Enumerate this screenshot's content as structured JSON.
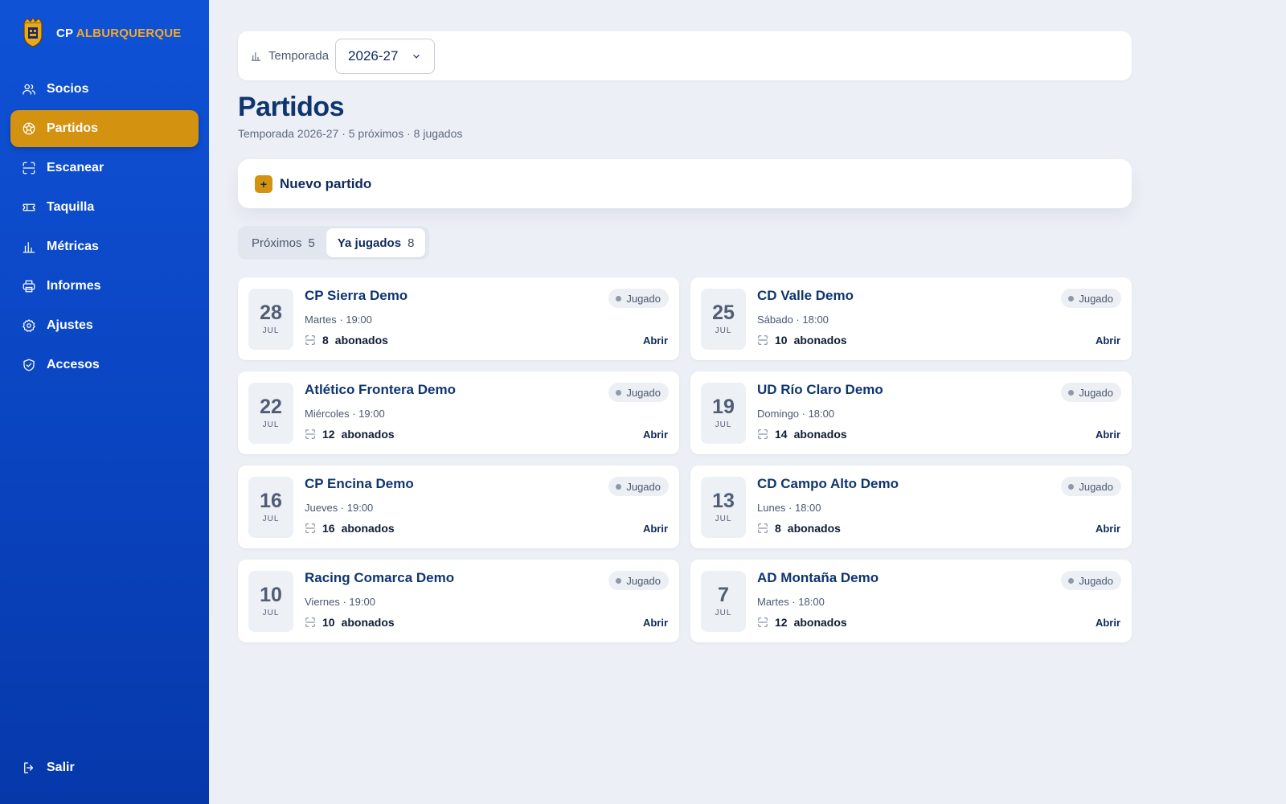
{
  "brand": {
    "prefix": "CP",
    "name": "ALBURQUERQUE",
    "logo_icon": "club-crest-icon",
    "accent_color": "#f0a92a"
  },
  "sidebar": {
    "items": [
      {
        "label": "Socios",
        "icon": "users-icon",
        "active": false
      },
      {
        "label": "Partidos",
        "icon": "soccer-ball-icon",
        "active": true
      },
      {
        "label": "Escanear",
        "icon": "scan-icon",
        "active": false
      },
      {
        "label": "Taquilla",
        "icon": "ticket-icon",
        "active": false
      },
      {
        "label": "Métricas",
        "icon": "bar-chart-icon",
        "active": false
      },
      {
        "label": "Informes",
        "icon": "printer-icon",
        "active": false
      },
      {
        "label": "Ajustes",
        "icon": "gear-icon",
        "active": false
      },
      {
        "label": "Accesos",
        "icon": "shield-icon",
        "active": false
      }
    ],
    "logout_label": "Salir"
  },
  "season": {
    "label": "Temporada",
    "selected": "2026-27"
  },
  "page": {
    "title": "Partidos",
    "subtitle": "Temporada 2026-27 · 5 próximos · 8 jugados"
  },
  "new_match": {
    "label": "Nuevo partido",
    "icon": "+"
  },
  "tabs": [
    {
      "label": "Próximos",
      "count": "5",
      "active": false
    },
    {
      "label": "Ya jugados",
      "count": "8",
      "active": true
    }
  ],
  "matches": [
    {
      "day": "28",
      "month": "JUL",
      "name": "CP Sierra Demo",
      "when": "Martes · 19:00",
      "subscribers": "8",
      "subscribers_label": "abonados",
      "status": "Jugado",
      "action": "Abrir"
    },
    {
      "day": "25",
      "month": "JUL",
      "name": "CD Valle Demo",
      "when": "Sábado · 18:00",
      "subscribers": "10",
      "subscribers_label": "abonados",
      "status": "Jugado",
      "action": "Abrir"
    },
    {
      "day": "22",
      "month": "JUL",
      "name": "Atlético Frontera Demo",
      "when": "Miércoles · 19:00",
      "subscribers": "12",
      "subscribers_label": "abonados",
      "status": "Jugado",
      "action": "Abrir"
    },
    {
      "day": "19",
      "month": "JUL",
      "name": "UD Río Claro Demo",
      "when": "Domingo · 18:00",
      "subscribers": "14",
      "subscribers_label": "abonados",
      "status": "Jugado",
      "action": "Abrir"
    },
    {
      "day": "16",
      "month": "JUL",
      "name": "CP Encina Demo",
      "when": "Jueves · 19:00",
      "subscribers": "16",
      "subscribers_label": "abonados",
      "status": "Jugado",
      "action": "Abrir"
    },
    {
      "day": "13",
      "month": "JUL",
      "name": "CD Campo Alto Demo",
      "when": "Lunes · 18:00",
      "subscribers": "8",
      "subscribers_label": "abonados",
      "status": "Jugado",
      "action": "Abrir"
    },
    {
      "day": "10",
      "month": "JUL",
      "name": "Racing Comarca Demo",
      "when": "Viernes · 19:00",
      "subscribers": "10",
      "subscribers_label": "abonados",
      "status": "Jugado",
      "action": "Abrir"
    },
    {
      "day": "7",
      "month": "JUL",
      "name": "AD Montaña Demo",
      "when": "Martes · 18:00",
      "subscribers": "12",
      "subscribers_label": "abonados",
      "status": "Jugado",
      "action": "Abrir"
    }
  ],
  "colors": {
    "sidebar": "#0a44c0",
    "active_item": "#d39310",
    "title": "#0f3570"
  }
}
